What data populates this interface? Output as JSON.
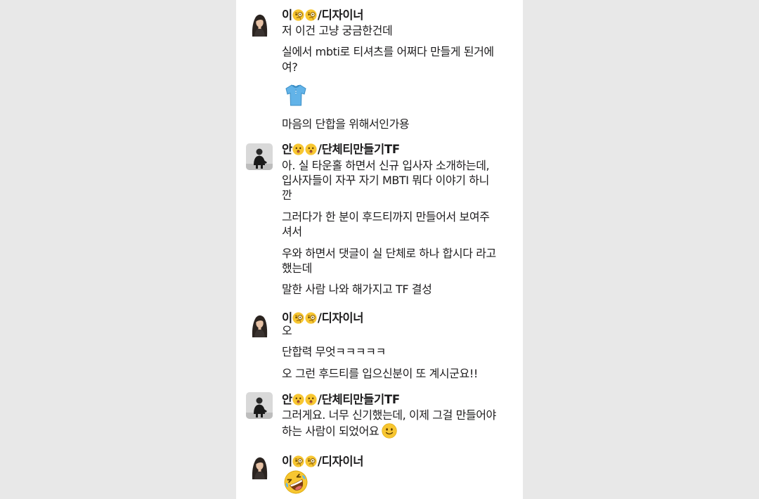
{
  "messages": [
    {
      "sender_prefix": "이",
      "sender_suffix": "/디자이너",
      "sender_emojis": [
        "face-with-monocle-icon",
        "face-with-monocle-icon"
      ],
      "lines": [
        "저 이건 고냥 궁금한건데",
        "실에서 mbti로 티셔츠를 어쩌다 만들게 된거에",
        "여?",
        "마음의 단합을 위해서인가용"
      ],
      "emoji": "tshirt-icon"
    },
    {
      "sender_prefix": "안",
      "sender_suffix": "/단체티만들기TF",
      "sender_emojis": [
        "hushed-face-icon",
        "hushed-face-icon"
      ],
      "lines": [
        "아. 실 타운홀 하면서 신규 입사자 소개하는데,",
        "입사자들이 자꾸 자기 MBTI 뭐다 이야기 하니",
        "깐",
        "그러다가 한 분이 후드티까지 만들어서 보여주",
        "셔서",
        "우와 하면서 댓글이 실 단체로 하나 합시다 라고",
        "했는데",
        "말한 사람 나와 해가지고 TF 결성"
      ]
    },
    {
      "sender_prefix": "이",
      "sender_suffix": "/디자이너",
      "sender_emojis": [
        "face-with-monocle-icon",
        "face-with-monocle-icon"
      ],
      "lines": [
        "오",
        "단합력 무엇ㅋㅋㅋㅋㅋ",
        "오 그런 후드티를 입으신분이 또 계시군요!!"
      ]
    },
    {
      "sender_prefix": "안",
      "sender_suffix": "/단체티만들기TF",
      "sender_emojis": [
        "hushed-face-icon",
        "hushed-face-icon"
      ],
      "lines": [
        "그러게요. 너무 신기했는데, 이제 그걸 만들어야",
        "하는 사람이 되었어요"
      ],
      "inline_emoji": "slightly-smiling-face-icon"
    },
    {
      "sender_prefix": "이",
      "sender_suffix": "/디자이너",
      "sender_emojis": [
        "face-with-monocle-icon",
        "face-with-monocle-icon"
      ],
      "emoji": "rolling-on-floor-laughing-icon"
    }
  ],
  "colors": {
    "background": "#e8e8e8",
    "panel": "#ffffff",
    "text": "#1d1c1d"
  }
}
